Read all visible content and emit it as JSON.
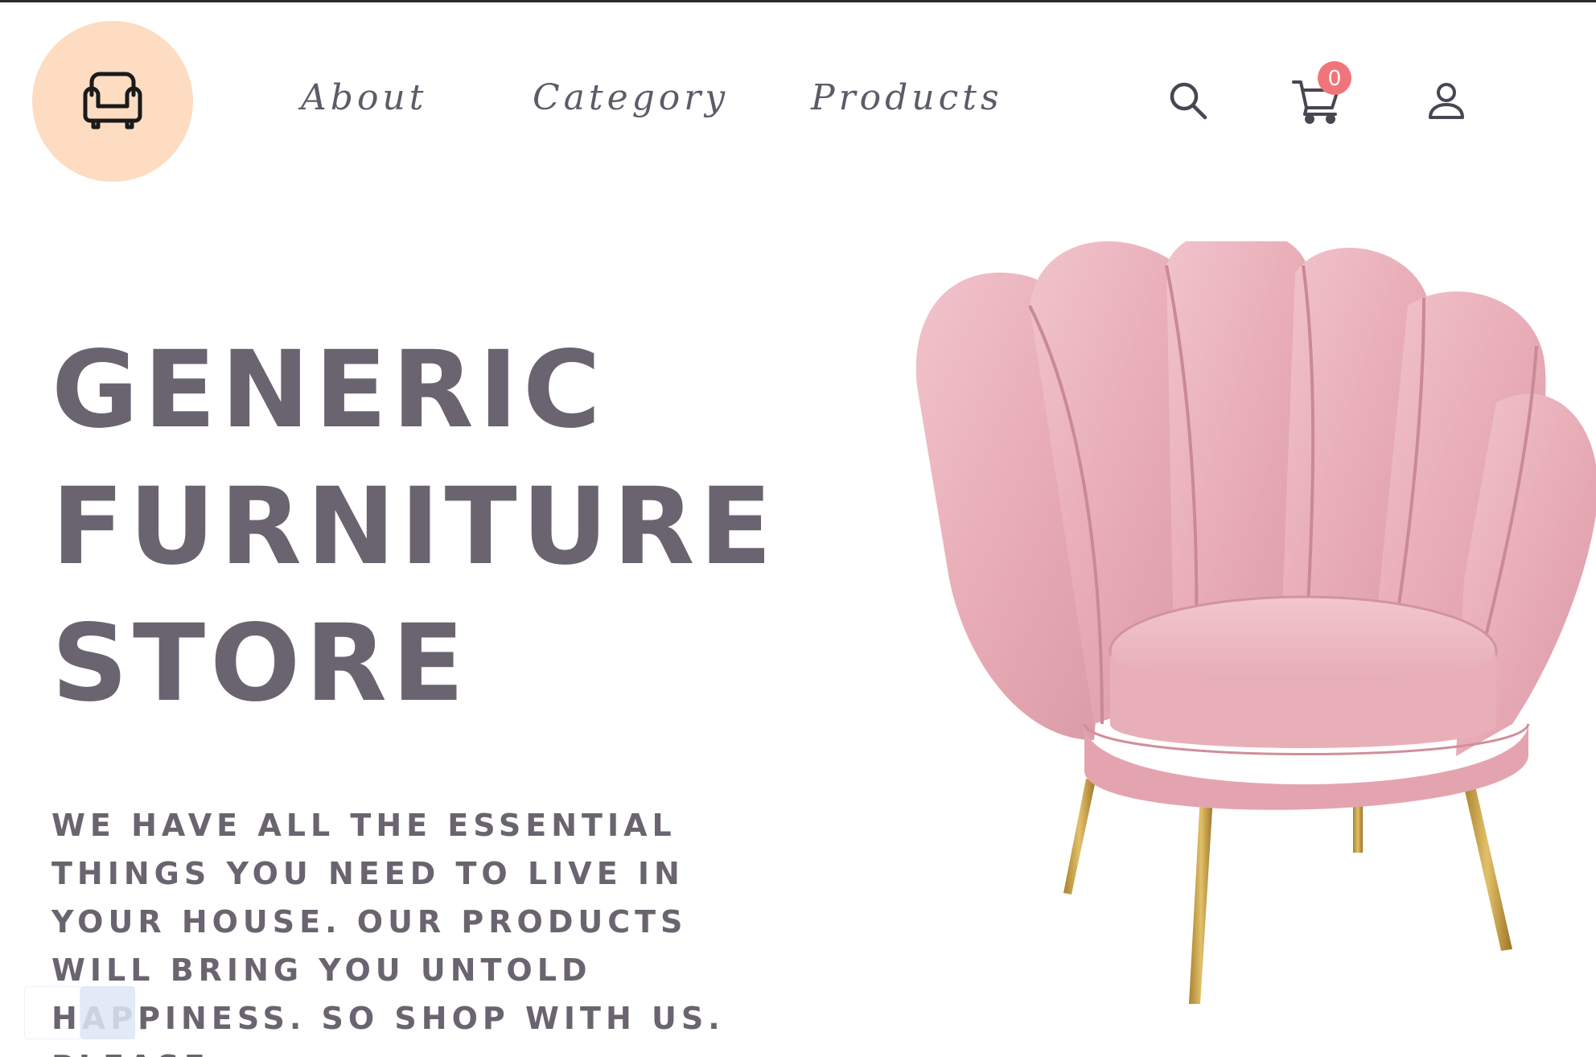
{
  "header": {
    "logo_icon": "armchair-icon",
    "logo_bg": "#fedcc1",
    "nav": [
      {
        "label": "About"
      },
      {
        "label": "Category"
      },
      {
        "label": "Products"
      }
    ],
    "icons": {
      "search": "search-icon",
      "cart": "cart-icon",
      "user": "user-icon"
    },
    "cart_count": "0",
    "badge_color": "#f0757a"
  },
  "hero": {
    "title_lines": [
      "GENERIC",
      "FURNITURE",
      "STORE"
    ],
    "tagline": "WE HAVE ALL THE ESSENTIAL THINGS YOU NEED TO LIVE IN YOUR HOUSE. OUR PRODUCTS WILL BRING YOU UNTOLD HAPPINESS. SO SHOP WITH US. PLEASE.",
    "text_color": "#6a6470",
    "image": "pink-scallop-armchair"
  }
}
